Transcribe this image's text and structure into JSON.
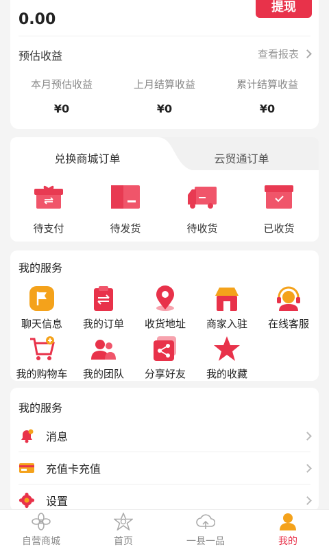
{
  "earnings": {
    "balance": "0.00",
    "withdraw_label": "提现",
    "estimated_label": "预估收益",
    "view_report_label": "查看报表",
    "stats": [
      {
        "label": "本月预估收益",
        "value": "¥0"
      },
      {
        "label": "上月结算收益",
        "value": "¥0"
      },
      {
        "label": "累计结算收益",
        "value": "¥0"
      }
    ]
  },
  "orders": {
    "tabs": [
      {
        "label": "兑换商城订单",
        "active": true
      },
      {
        "label": "云贸通订单",
        "active": false
      }
    ],
    "statuses": [
      {
        "label": "待支付",
        "icon": "gift-box-icon"
      },
      {
        "label": "待发货",
        "icon": "package-icon"
      },
      {
        "label": "待收货",
        "icon": "delivery-truck-icon"
      },
      {
        "label": "已收货",
        "icon": "received-box-icon"
      }
    ]
  },
  "services": {
    "title": "我的服务",
    "items": [
      {
        "label": "聊天信息",
        "icon": "chat-flag-icon"
      },
      {
        "label": "我的订单",
        "icon": "order-clipboard-icon"
      },
      {
        "label": "收货地址",
        "icon": "location-pin-icon"
      },
      {
        "label": "商家入驻",
        "icon": "storefront-icon"
      },
      {
        "label": "在线客服",
        "icon": "headset-icon"
      },
      {
        "label": "我的购物车",
        "icon": "shopping-cart-icon"
      },
      {
        "label": "我的团队",
        "icon": "team-icon"
      },
      {
        "label": "分享好友",
        "icon": "share-icon"
      },
      {
        "label": "我的收藏",
        "icon": "star-icon"
      }
    ]
  },
  "service_list": {
    "title": "我的服务",
    "items": [
      {
        "label": "消息",
        "icon": "bell-icon"
      },
      {
        "label": "充值卡充值",
        "icon": "vip-card-icon"
      },
      {
        "label": "设置",
        "icon": "settings-gear-icon"
      }
    ]
  },
  "nav": {
    "items": [
      {
        "label": "自营商城",
        "icon": "flower-icon",
        "active": false
      },
      {
        "label": "首页",
        "icon": "home-star-icon",
        "active": false
      },
      {
        "label": "一县一品",
        "icon": "cloud-icon",
        "active": false
      },
      {
        "label": "我的",
        "icon": "user-icon",
        "active": true
      }
    ]
  },
  "colors": {
    "accent": "#e8324a",
    "background": "#f4f4f4"
  }
}
